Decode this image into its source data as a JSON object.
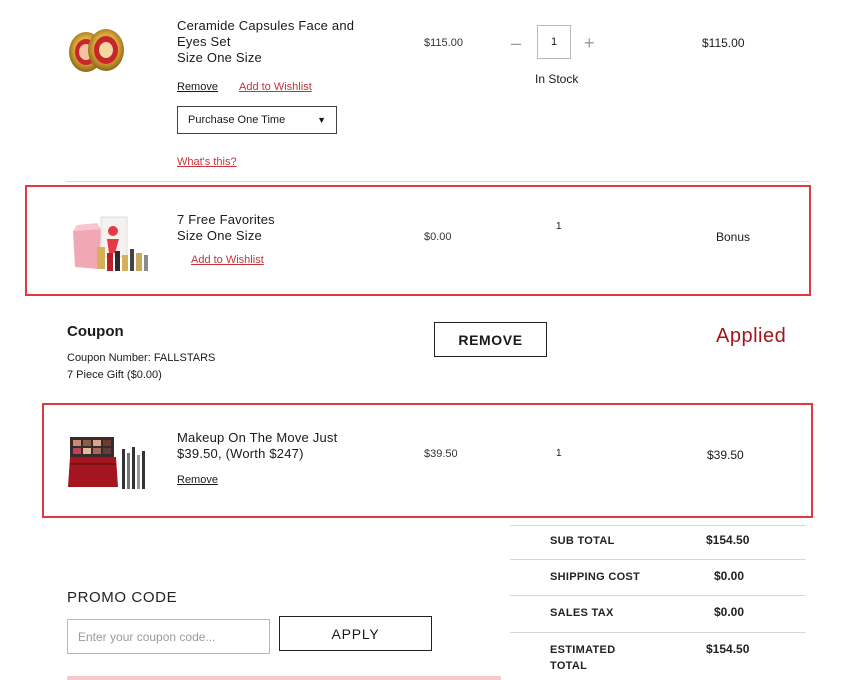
{
  "items": [
    {
      "name": "Ceramide Capsules Face and Eyes Set",
      "size": "Size One Size",
      "price": "$115.00",
      "qty": "1",
      "stock": "In Stock",
      "total": "$115.00",
      "remove": "Remove",
      "wishlist": "Add to Wishlist",
      "purchase_option": "Purchase One Time",
      "whats_this": "What's this?",
      "image_icon": "gold-capsules-icon"
    },
    {
      "name": "7 Free Favorites",
      "size": "Size One Size",
      "price": "$0.00",
      "qty": "1",
      "total": "Bonus",
      "wishlist": "Add to Wishlist",
      "image_icon": "gift-bag-icon"
    },
    {
      "name_line1": "Makeup On The Move Just",
      "name_line2": "$39.50, (Worth $247)",
      "price": "$39.50",
      "qty": "1",
      "total": "$39.50",
      "remove": "Remove",
      "image_icon": "makeup-case-icon"
    }
  ],
  "coupon": {
    "title": "Coupon",
    "number": "Coupon Number: FALLSTARS",
    "gift": "7 Piece Gift ($0.00)",
    "remove_button": "REMOVE",
    "status": "Applied"
  },
  "summary": [
    {
      "label": "SUB TOTAL",
      "value": "$154.50"
    },
    {
      "label": "SHIPPING COST",
      "value": "$0.00"
    },
    {
      "label": "SALES TAX",
      "value": "$0.00"
    },
    {
      "label_line1": "ESTIMATED",
      "label_line2": "TOTAL",
      "value": "$154.50"
    }
  ],
  "promo": {
    "title": "PROMO CODE",
    "placeholder": "Enter your coupon code...",
    "apply_button": "APPLY"
  },
  "colors": {
    "highlight": "#e1383e",
    "accent_red": "#c8323b",
    "applied": "#a8141c"
  }
}
